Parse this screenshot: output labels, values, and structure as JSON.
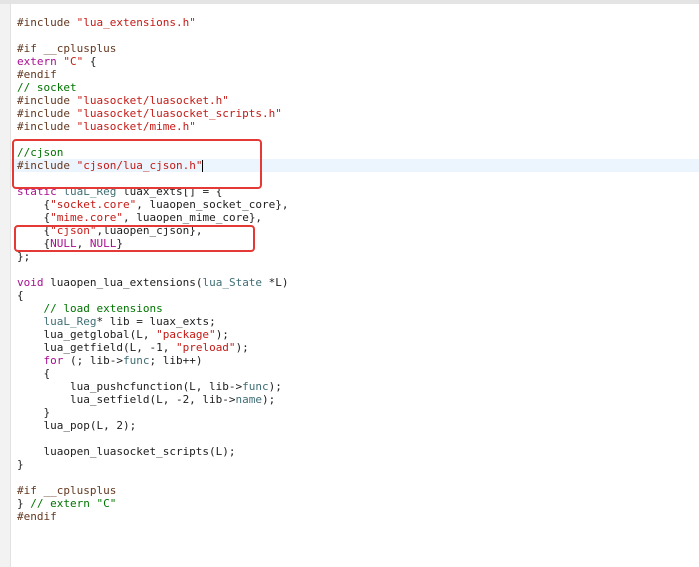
{
  "editor": {
    "lines": [
      [
        {
          "t": "#include ",
          "c": "pp"
        },
        {
          "t": "\"lua_extensions.h\"",
          "c": "str"
        }
      ],
      [],
      [
        {
          "t": "#if __cplusplus",
          "c": "pp"
        }
      ],
      [
        {
          "t": "extern",
          "c": "kw"
        },
        {
          "t": " ",
          "c": "id"
        },
        {
          "t": "\"C\"",
          "c": "str"
        },
        {
          "t": " {",
          "c": "id"
        }
      ],
      [
        {
          "t": "#endif",
          "c": "pp"
        }
      ],
      [
        {
          "t": "// socket",
          "c": "cmt"
        }
      ],
      [
        {
          "t": "#include ",
          "c": "pp"
        },
        {
          "t": "\"luasocket/luasocket.h\"",
          "c": "str"
        }
      ],
      [
        {
          "t": "#include ",
          "c": "pp"
        },
        {
          "t": "\"luasocket/luasocket_scripts.h\"",
          "c": "str"
        }
      ],
      [
        {
          "t": "#include ",
          "c": "pp"
        },
        {
          "t": "\"luasocket/mime.h\"",
          "c": "str"
        }
      ],
      [],
      [
        {
          "t": "//cjson",
          "c": "cmt"
        }
      ],
      [
        {
          "t": "#include ",
          "c": "pp"
        },
        {
          "t": "\"cjson/lua_cjson.h\"",
          "c": "str"
        },
        {
          "t": "",
          "c": "caret"
        }
      ],
      [],
      [
        {
          "t": "static",
          "c": "kw"
        },
        {
          "t": " ",
          "c": "id"
        },
        {
          "t": "luaL_Reg",
          "c": "type"
        },
        {
          "t": " luax_exts[] = {",
          "c": "id"
        }
      ],
      [
        {
          "t": "    {",
          "c": "id"
        },
        {
          "t": "\"socket.core\"",
          "c": "str"
        },
        {
          "t": ", luaopen_socket_core},",
          "c": "id"
        }
      ],
      [
        {
          "t": "    {",
          "c": "id"
        },
        {
          "t": "\"mime.core\"",
          "c": "str"
        },
        {
          "t": ", luaopen_mime_core},",
          "c": "id"
        }
      ],
      [
        {
          "t": "    {",
          "c": "id"
        },
        {
          "t": "\"cjson\"",
          "c": "str"
        },
        {
          "t": ",luaopen_cjson},",
          "c": "id"
        }
      ],
      [
        {
          "t": "    {",
          "c": "id"
        },
        {
          "t": "NULL",
          "c": "kw"
        },
        {
          "t": ", ",
          "c": "id"
        },
        {
          "t": "NULL",
          "c": "kw"
        },
        {
          "t": "}",
          "c": "id"
        }
      ],
      [
        {
          "t": "};",
          "c": "id"
        }
      ],
      [],
      [
        {
          "t": "void",
          "c": "kw"
        },
        {
          "t": " luaopen_lua_extensions(",
          "c": "id"
        },
        {
          "t": "lua_State",
          "c": "type"
        },
        {
          "t": " *L)",
          "c": "id"
        }
      ],
      [
        {
          "t": "{",
          "c": "id"
        }
      ],
      [
        {
          "t": "    // load extensions",
          "c": "cmt"
        }
      ],
      [
        {
          "t": "    ",
          "c": "id"
        },
        {
          "t": "luaL_Reg",
          "c": "type"
        },
        {
          "t": "* lib = luax_exts;",
          "c": "id"
        }
      ],
      [
        {
          "t": "    lua_getglobal(L, ",
          "c": "id"
        },
        {
          "t": "\"package\"",
          "c": "str"
        },
        {
          "t": ");",
          "c": "id"
        }
      ],
      [
        {
          "t": "    lua_getfield(L, -1, ",
          "c": "id"
        },
        {
          "t": "\"preload\"",
          "c": "str"
        },
        {
          "t": ");",
          "c": "id"
        }
      ],
      [
        {
          "t": "    ",
          "c": "id"
        },
        {
          "t": "for",
          "c": "kw"
        },
        {
          "t": " (; lib->",
          "c": "id"
        },
        {
          "t": "func",
          "c": "mem"
        },
        {
          "t": "; lib++)",
          "c": "id"
        }
      ],
      [
        {
          "t": "    {",
          "c": "id"
        }
      ],
      [
        {
          "t": "        lua_pushcfunction(L, lib->",
          "c": "id"
        },
        {
          "t": "func",
          "c": "mem"
        },
        {
          "t": ");",
          "c": "id"
        }
      ],
      [
        {
          "t": "        lua_setfield(L, -2, lib->",
          "c": "id"
        },
        {
          "t": "name",
          "c": "mem"
        },
        {
          "t": ");",
          "c": "id"
        }
      ],
      [
        {
          "t": "    }",
          "c": "id"
        }
      ],
      [
        {
          "t": "    lua_pop(L, 2);",
          "c": "id"
        }
      ],
      [],
      [
        {
          "t": "    luaopen_luasocket_scripts(L);",
          "c": "id"
        }
      ],
      [
        {
          "t": "}",
          "c": "id"
        }
      ],
      [],
      [
        {
          "t": "#if __cplusplus",
          "c": "pp"
        }
      ],
      [
        {
          "t": "} ",
          "c": "id"
        },
        {
          "t": "// extern \"C\"",
          "c": "cmt"
        }
      ],
      [
        {
          "t": "#endif",
          "c": "pp"
        }
      ]
    ],
    "current_line": 11
  },
  "annotations": [
    {
      "name": "cjson-include-highlight",
      "color": "#e53935"
    },
    {
      "name": "cjson-registration-highlight",
      "color": "#e53935"
    }
  ]
}
